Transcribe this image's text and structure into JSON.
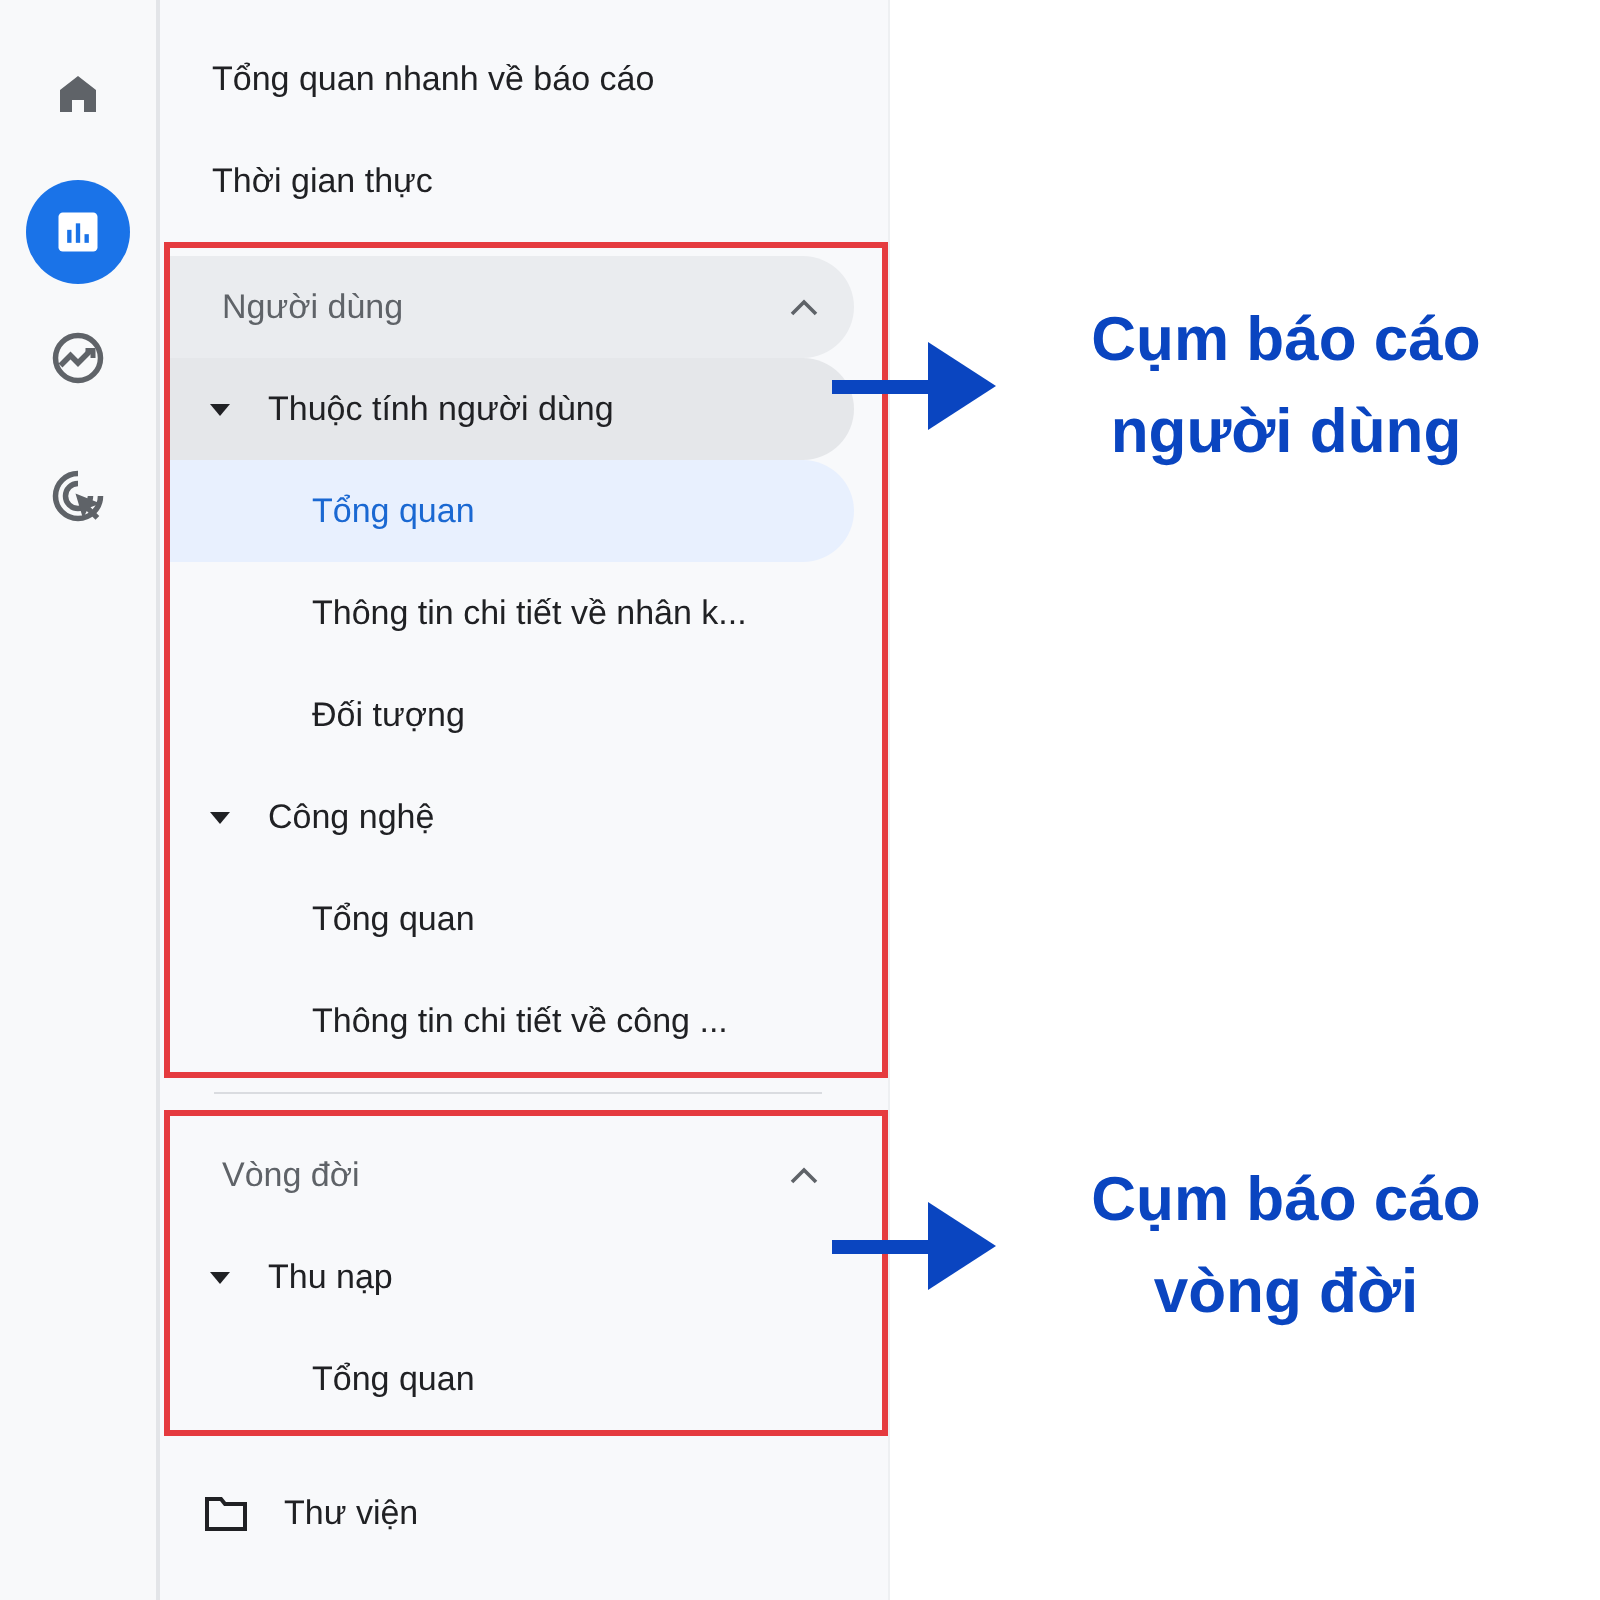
{
  "rail": [
    {
      "kind": "home",
      "selected": false
    },
    {
      "kind": "reports",
      "selected": true
    },
    {
      "kind": "explore",
      "selected": false
    },
    {
      "kind": "advertising",
      "selected": false
    }
  ],
  "top_items": [
    "Tổng quan nhanh về báo cáo",
    "Thời gian thực"
  ],
  "sections": [
    {
      "title": "Người dùng",
      "expanded": true,
      "highlighted": true,
      "framed": true,
      "groups": [
        {
          "label": "Thuộc tính người dùng",
          "expanded": true,
          "highlighted": true,
          "children": [
            {
              "label": "Tổng quan",
              "selected": true
            },
            {
              "label": "Thông tin chi tiết về nhân k...",
              "selected": false
            },
            {
              "label": "Đối tượng",
              "selected": false
            }
          ]
        },
        {
          "label": "Công nghệ",
          "expanded": true,
          "highlighted": false,
          "children": [
            {
              "label": "Tổng quan",
              "selected": false
            },
            {
              "label": "Thông tin chi tiết về công ...",
              "selected": false
            }
          ]
        }
      ]
    },
    {
      "title": "Vòng đời",
      "expanded": true,
      "highlighted": false,
      "framed": true,
      "groups": [
        {
          "label": "Thu nạp",
          "expanded": true,
          "highlighted": false,
          "children": [
            {
              "label": "Tổng quan",
              "selected": false
            }
          ]
        }
      ]
    }
  ],
  "library": "Thư viện",
  "annotations": [
    {
      "lines": [
        "Cụm báo cáo",
        "người dùng"
      ]
    },
    {
      "lines": [
        "Cụm báo cáo",
        "vòng đời"
      ]
    }
  ]
}
